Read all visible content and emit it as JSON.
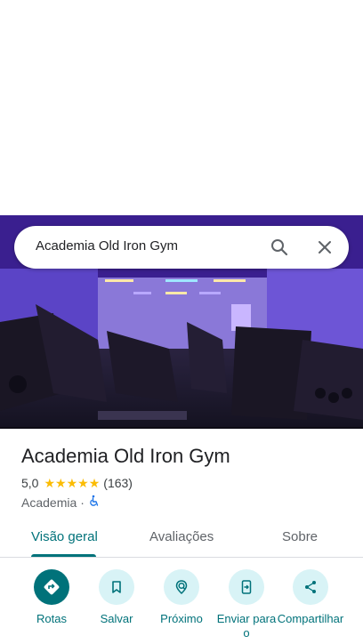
{
  "search": {
    "query": "Academia Old Iron Gym"
  },
  "place": {
    "name": "Academia Old Iron Gym",
    "rating": "5,0",
    "stars": 5,
    "review_count": "(163)",
    "category": "Academia",
    "separator": "·"
  },
  "tabs": [
    {
      "label": "Visão geral",
      "active": true
    },
    {
      "label": "Avaliações",
      "active": false
    },
    {
      "label": "Sobre",
      "active": false
    }
  ],
  "actions": [
    {
      "label": "Rotas",
      "icon": "directions-icon"
    },
    {
      "label": "Salvar",
      "icon": "bookmark-icon"
    },
    {
      "label": "Próximo",
      "icon": "nearby-icon"
    },
    {
      "label": "Enviar para o",
      "icon": "send-to-phone-icon"
    },
    {
      "label": "Compartilhar",
      "icon": "share-icon"
    }
  ],
  "colors": {
    "accent": "#00727a",
    "accent_light": "#d8f3f6",
    "star": "#fbbc04"
  }
}
